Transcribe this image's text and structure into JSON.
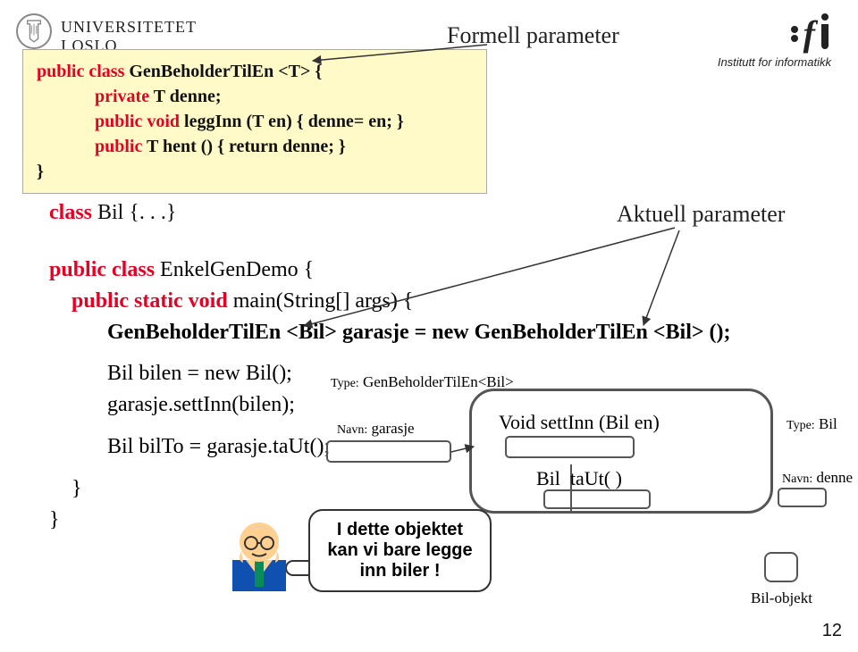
{
  "header": {
    "uio": "UNIVERSITETET\nI OSLO",
    "ifi_caption": "Institutt for informatikk"
  },
  "labels": {
    "formell": "Formell parameter",
    "aktuell": "Aktuell parameter"
  },
  "codebox": {
    "l1_kw": "public class",
    "l1_txt": " GenBeholderTilEn <T>  {",
    "l2_kw": "private",
    "l2_txt": " T denne;",
    "l3_kw": "public void",
    "l3_txt": " leggInn (T en)   { denne= en; }",
    "l4_kw": "public",
    "l4_txt": " T hent () {     return denne;   }",
    "l5_txt": "}"
  },
  "mid": {
    "kw": "class",
    "txt": " Bil {. . .}"
  },
  "lower": {
    "l1_kw": "public class",
    "l1_txt": " EnkelGenDemo {",
    "l2_kw": "public static void",
    "l2_txt": " main(String[] args) {",
    "l3": "GenBeholderTilEn <Bil>   garasje = new GenBeholderTilEn <Bil> ();",
    "l4": "Bil bilen  = new Bil();",
    "l5": "garasje.settInn(bilen);",
    "l6": "Bil  bilTo = garasje.taUt();",
    "l7": "}",
    "l8": "}"
  },
  "obj": {
    "type_lbl": "Type:",
    "type_val": "GenBeholderTilEn<Bil>",
    "navn_lbl": "Navn:",
    "navn_val": "garasje",
    "row1": "Void settInn (Bil en)",
    "row2a": "Bil",
    "row2b": "taUt( )"
  },
  "bil": {
    "type_lbl": "Type:",
    "type_val": "Bil",
    "navn_lbl": "Navn:",
    "navn_val": "denne",
    "objekt": "Bil-objekt"
  },
  "speech": "I dette objektet kan vi bare legge inn biler !",
  "page": "12"
}
